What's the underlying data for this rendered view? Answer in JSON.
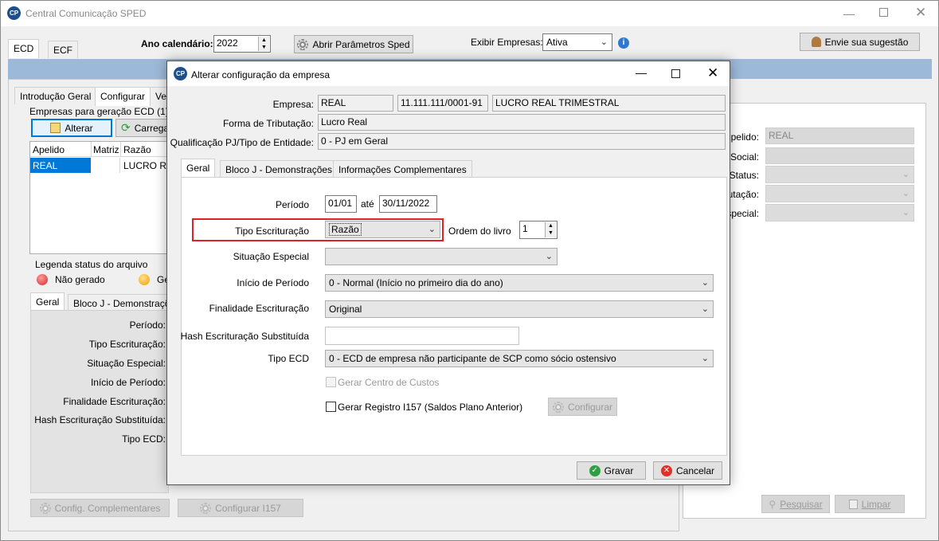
{
  "main": {
    "title": "Central Comunicação SPED",
    "tabs": [
      "ECD",
      "ECF"
    ],
    "ano_label": "Ano calendário:",
    "ano_value": "2022",
    "abrir_params": "Abrir Parâmetros Sped",
    "exibir_label": "Exibir Empresas:",
    "exibir_value": "Ativa",
    "sugestao": "Envie sua sugestão",
    "subtabs": [
      "Introdução Geral",
      "Configurar",
      "Ver"
    ],
    "empresas_group": "Empresas para geração ECD (1)",
    "alterar": "Alterar",
    "carregar": "Carrega",
    "table": {
      "headers": [
        "Apelido",
        "Matriz",
        "Razão"
      ],
      "rows": [
        [
          "REAL",
          "",
          "LUCRO RE"
        ]
      ]
    },
    "legenda": "Legenda status do arquivo",
    "nao_gerado": "Não gerado",
    "gerado": "Ge",
    "detail_tabs": [
      "Geral",
      "Bloco J - Demonstraçõ"
    ],
    "detail_labels": [
      "Período:",
      "Tipo Escrituração:",
      "Situação Especial:",
      "Início de Período:",
      "Finalidade Escrituração:",
      "Hash Escrituração Substituída:",
      "Tipo ECD:"
    ],
    "config_compl": "Config. Complementares",
    "config_i157": "Configurar I157",
    "right_labels": [
      "pelido:",
      "Social:",
      "Status:",
      "utação:",
      "special:"
    ],
    "right_apelido": "REAL",
    "pesquisar": "Pesquisar",
    "limpar": "Limpar"
  },
  "dialog": {
    "title": "Alterar configuração da empresa",
    "empresa_label": "Empresa:",
    "empresa_nome": "REAL",
    "empresa_cnpj": "11.111.111/0001-91",
    "empresa_razao": "LUCRO REAL TRIMESTRAL",
    "forma_label": "Forma de Tributação:",
    "forma_value": "Lucro Real",
    "qualif_label": "Qualificação PJ/Tipo de Entidade:",
    "qualif_value": "0 - PJ em Geral",
    "tabs": [
      "Geral",
      "Bloco J - Demonstrações",
      "Informações Complementares"
    ],
    "periodo_label": "Período",
    "periodo_inicio": "01/01",
    "ate": "até",
    "periodo_fim": "30/11/2022",
    "tipo_escrit_label": "Tipo Escrituração",
    "tipo_escrit_value": "Razão",
    "ordem_label": "Ordem do livro",
    "ordem_value": "1",
    "situacao_label": "Situação Especial",
    "situacao_value": "",
    "inicio_label": "Início de Período",
    "inicio_value": "0 - Normal (Início no primeiro dia do ano)",
    "finalidade_label": "Finalidade Escrituração",
    "finalidade_value": "Original",
    "hash_label": "Hash Escrituração Substituída",
    "hash_value": "",
    "tipo_ecd_label": "Tipo ECD",
    "tipo_ecd_value": "0 - ECD de empresa não participante de SCP como sócio ostensivo",
    "gerar_centro": "Gerar Centro de Custos",
    "gerar_i157": "Gerar Registro I157 (Saldos Plano Anterior)",
    "configurar": "Configurar",
    "gravar": "Gravar",
    "cancelar": "Cancelar"
  },
  "colors": {
    "highlight": "#e0202a",
    "selection": "#0078d7",
    "banner": "#9db9d9"
  }
}
